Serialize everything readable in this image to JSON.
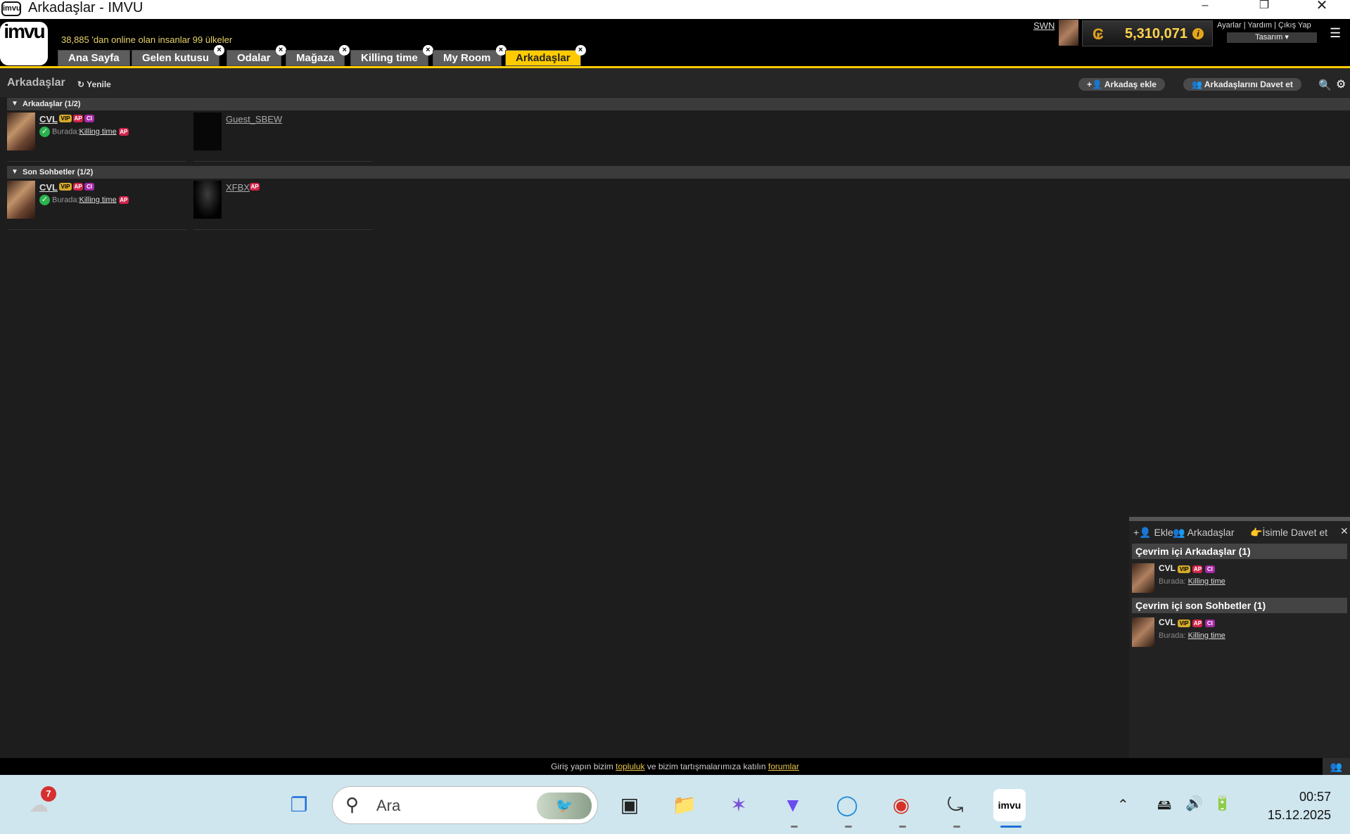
{
  "window": {
    "title": "Arkadaşlar - IMVU",
    "logo": "imvu"
  },
  "header": {
    "online_text": "38,885 'dan online olan insanlar 99 ülkeler",
    "username": "SWN",
    "credits": "5,310,071",
    "links": "Ayarlar  |  Yardım  |  Çıkış Yap",
    "design_label": "Tasarım",
    "logo_text": "imvu"
  },
  "tabs": [
    {
      "label": "Ana Sayfa"
    },
    {
      "label": "Gelen kutusu"
    },
    {
      "label": "Odalar"
    },
    {
      "label": "Mağaza"
    },
    {
      "label": "Killing time"
    },
    {
      "label": "My Room"
    },
    {
      "label": "Arkadaşlar"
    }
  ],
  "toolbar": {
    "title": "Arkadaşlar",
    "refresh": "Yenile",
    "add_friend": "Arkadaş ekle",
    "invite": "Arkadaşlarını Davet et"
  },
  "sections": {
    "friends": {
      "title": "Arkadaşlar (1/2)",
      "items": [
        {
          "name": "CVL",
          "badges": [
            "VIP",
            "AP",
            "CI"
          ],
          "status_prefix": "Burada:",
          "room": "Killing time"
        },
        {
          "name": "Guest_SBEW",
          "badges": [],
          "status_prefix": "",
          "room": ""
        }
      ]
    },
    "recent": {
      "title": "Son Sohbetler (1/2)",
      "items": [
        {
          "name": "CVL",
          "badges": [
            "VIP",
            "AP",
            "CI"
          ],
          "status_prefix": "Burada:",
          "room": "Killing time"
        },
        {
          "name": "XFBX",
          "badges": [
            "AP"
          ],
          "status_prefix": "",
          "room": ""
        }
      ]
    }
  },
  "panel": {
    "tab_add": "Ekle",
    "tab_friends": "Arkadaşlar",
    "tab_invite": "İsimle Davet et",
    "online_friends_title": "Çevrim içi Arkadaşlar (1)",
    "online_recent_title": "Çevrim içi son Sohbetler (1)",
    "friend": {
      "name": "CVL",
      "status_prefix": "Burada:",
      "room": "Killing time"
    },
    "recent": {
      "name": "CVL",
      "status_prefix": "Burada:",
      "room": "Killing time"
    }
  },
  "footer": {
    "text1": "Giriş yapın bizim ",
    "link1": "topluluk",
    "text2": " ve bizim tartışmalarımıza katılın ",
    "link2": "forumlar"
  },
  "taskbar": {
    "weather_badge": "7",
    "search_placeholder": "Ara",
    "time": "00:57",
    "date": "15.12.2025"
  }
}
